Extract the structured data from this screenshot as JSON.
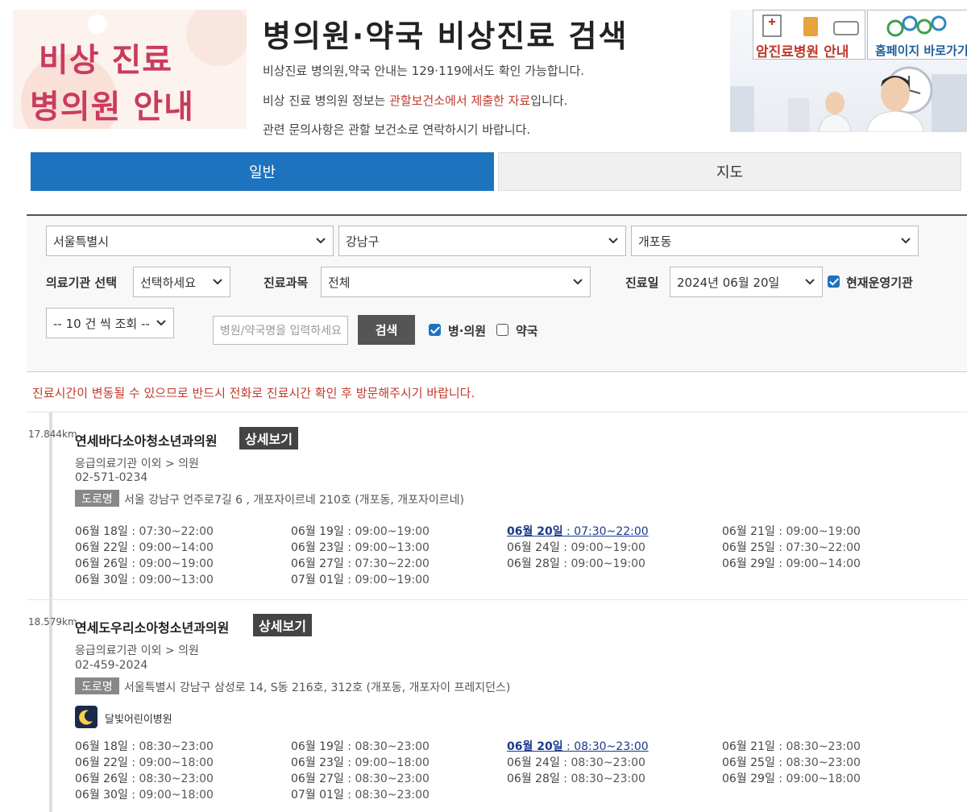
{
  "header": {
    "banner_line1": "비상 진료",
    "banner_line2": "병의원 안내",
    "title": "병의원·약국 비상진료 검색",
    "intro_line1": "비상진료 병의원,약국 안내는 129·119에서도 확인 가능합니다.",
    "intro_line2_pre": "비상 진료 병의원 정보는 ",
    "intro_line2_red": "관할보건소에서 제출한 자료",
    "intro_line2_post": "입니다.",
    "intro_line3": "관련 문의사항은 관할 보건소로 연락하시기 바랍니다.",
    "side_link1": "암진료병원 안내",
    "side_link2": "홈페이지 바로가기"
  },
  "tabs": {
    "general": "일반",
    "map": "지도",
    "active": "general"
  },
  "search": {
    "city": "서울특별시",
    "district": "강남구",
    "dong": "개포동",
    "inst_type_label": "의료기관 선택",
    "inst_type_value": "선택하세요",
    "dept_label": "진료과목",
    "dept_value": "전체",
    "date_label": "진료일",
    "date_value": "2024년 06월 20일",
    "operating_label": "현재운영기관",
    "operating_checked": true,
    "page_size": "-- 10 건 씩 조회 --",
    "name_placeholder": "병원/약국명을 입력하세요",
    "search_button": "검색",
    "clinic_label": "병·의원",
    "clinic_checked": true,
    "pharmacy_label": "약국",
    "pharmacy_checked": false
  },
  "notice": "진료시간이 변동될 수 있으므로 반드시 전화로 진료시간 확인 후 방문해주시기 바랍니다.",
  "results": [
    {
      "distance": "17.844km",
      "name": "연세바다소아청소년과의원",
      "detail_button": "상세보기",
      "category": "응급의료기관 이외 > 의원",
      "phone": "02-571-0234",
      "road_label": "도로명",
      "address": "서울 강남구 언주로7길 6 , 개포자이르네 210호 (개포동, 개포자이르네)",
      "badge": "",
      "hours": [
        {
          "day": "06월 18일",
          "time": " : 07:30~22:00"
        },
        {
          "day": "06월 19일",
          "time": " : 09:00~19:00"
        },
        {
          "day": "06월 20일",
          "time": " : 07:30~22:00",
          "today": true
        },
        {
          "day": "06월 21일",
          "time": " : 09:00~19:00"
        },
        {
          "day": "06월 22일",
          "time": " : 09:00~14:00"
        },
        {
          "day": "06월 23일",
          "time": " : 09:00~13:00"
        },
        {
          "day": "06월 24일",
          "time": " : 09:00~19:00"
        },
        {
          "day": "06월 25일",
          "time": " : 07:30~22:00"
        },
        {
          "day": "06월 26일",
          "time": " : 09:00~19:00"
        },
        {
          "day": "06월 27일",
          "time": " : 07:30~22:00"
        },
        {
          "day": "06월 28일",
          "time": " : 09:00~19:00"
        },
        {
          "day": "06월 29일",
          "time": " : 09:00~14:00"
        },
        {
          "day": "06월 30일",
          "time": " : 09:00~13:00"
        },
        {
          "day": "07월 01일",
          "time": " : 09:00~19:00"
        }
      ]
    },
    {
      "distance": "18.579km",
      "name": "연세도우리소아청소년과의원",
      "detail_button": "상세보기",
      "category": "응급의료기관 이외 > 의원",
      "phone": "02-459-2024",
      "road_label": "도로명",
      "address": "서울특별시 강남구 삼성로 14, S동 216호, 312호 (개포동, 개포자이 프레지던스)",
      "badge": "달빛어린이병원",
      "hours": [
        {
          "day": "06월 18일",
          "time": " : 08:30~23:00"
        },
        {
          "day": "06월 19일",
          "time": " : 08:30~23:00"
        },
        {
          "day": "06월 20일",
          "time": " : 08:30~23:00",
          "today": true
        },
        {
          "day": "06월 21일",
          "time": " : 08:30~23:00"
        },
        {
          "day": "06월 22일",
          "time": " : 09:00~18:00"
        },
        {
          "day": "06월 23일",
          "time": " : 09:00~18:00"
        },
        {
          "day": "06월 24일",
          "time": " : 08:30~23:00"
        },
        {
          "day": "06월 25일",
          "time": " : 08:30~23:00"
        },
        {
          "day": "06월 26일",
          "time": " : 08:30~23:00"
        },
        {
          "day": "06월 27일",
          "time": " : 08:30~23:00"
        },
        {
          "day": "06월 28일",
          "time": " : 08:30~23:00"
        },
        {
          "day": "06월 29일",
          "time": " : 09:00~18:00"
        },
        {
          "day": "06월 30일",
          "time": " : 09:00~18:00"
        },
        {
          "day": "07월 01일",
          "time": " : 08:30~23:00"
        }
      ]
    }
  ],
  "colors": {
    "primary": "#1e73be",
    "accent_red": "#c0392b",
    "banner_pink": "#c93b5f",
    "today_blue": "#1a3a8f"
  }
}
